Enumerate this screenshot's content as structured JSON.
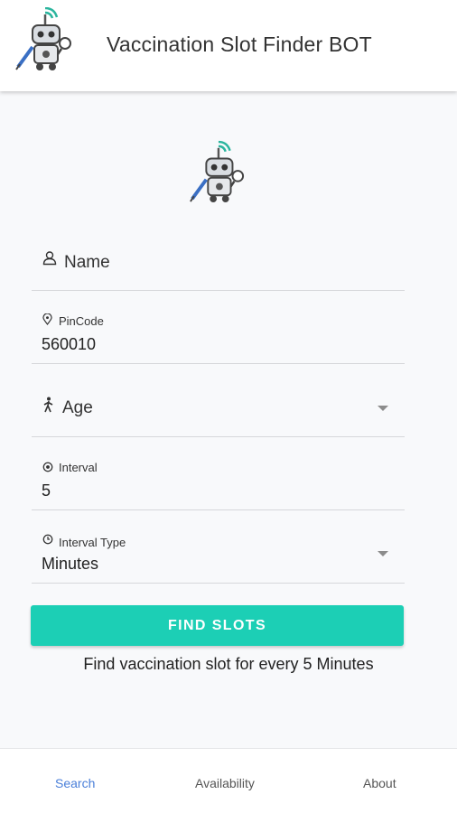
{
  "header": {
    "title": "Vaccination Slot Finder BOT",
    "logo_icon": "robot-doctor-icon"
  },
  "form": {
    "name": {
      "label": "Name",
      "icon": "person-icon"
    },
    "pincode": {
      "label": "PinCode",
      "value": "560010",
      "icon": "location-pin-icon"
    },
    "age": {
      "label": "Age",
      "icon": "walking-person-icon"
    },
    "interval": {
      "label": "Interval",
      "value": "5",
      "icon": "interval-icon"
    },
    "interval_type": {
      "label": "Interval Type",
      "value": "Minutes",
      "icon": "clock-icon"
    }
  },
  "actions": {
    "find_slots_label": "FIND SLOTS",
    "helper_text": "Find vaccination slot for every 5 Minutes"
  },
  "bottom_nav": {
    "items": [
      {
        "label": "Search",
        "active": true
      },
      {
        "label": "Availability",
        "active": false
      },
      {
        "label": "About",
        "active": false
      }
    ]
  },
  "colors": {
    "accent": "#1ccfb5",
    "active_nav": "#4a7fd9",
    "background": "#f8f9fb"
  }
}
